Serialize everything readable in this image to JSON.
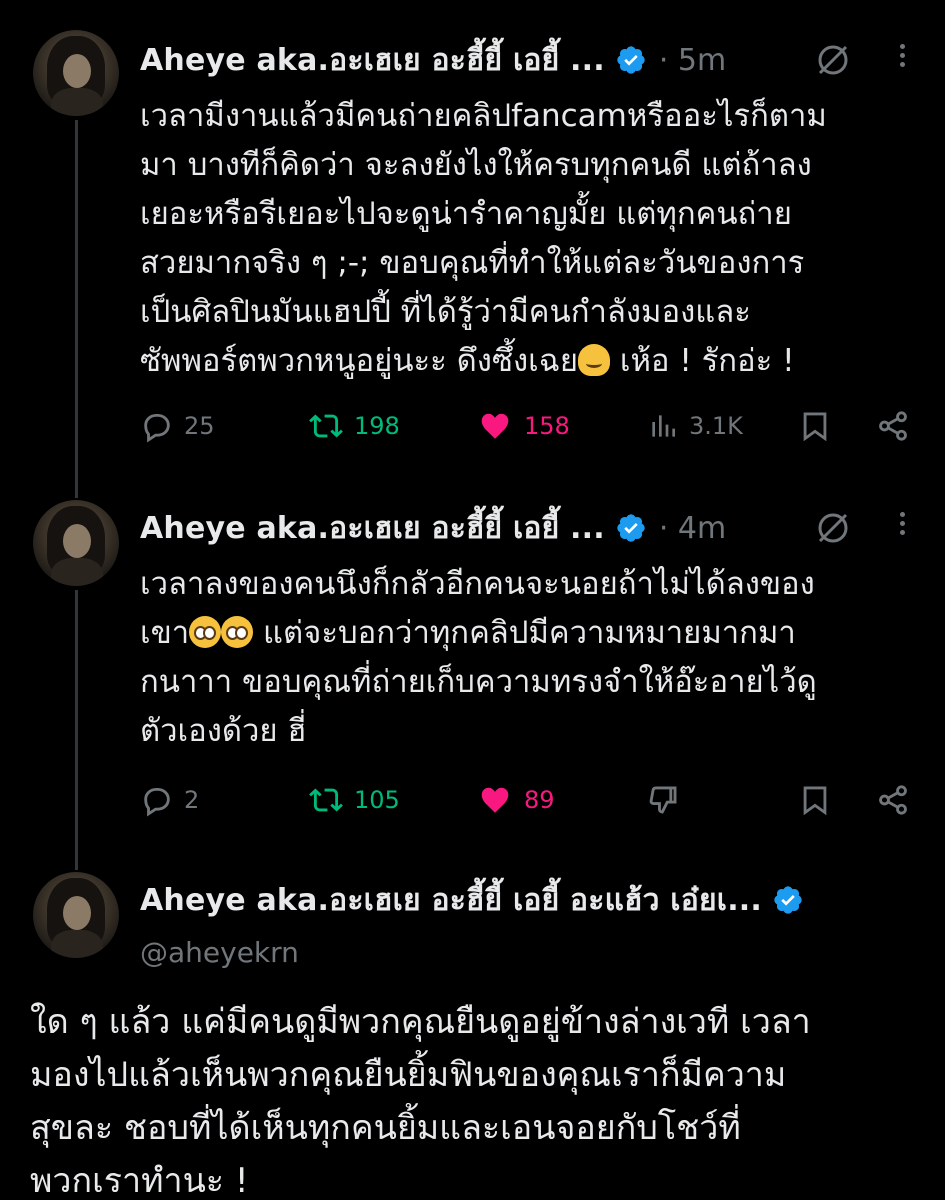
{
  "tweets": [
    {
      "name": "Aheye aka.อะเฮเย อะฮี้ยี้ เอยี้ ...",
      "time": "· 5m",
      "lines": [
        "เวลามีงานแล้วมีคนถ่ายคลิปfancamหรืออะไรก็ตาม",
        "มา บางทีก็คิดว่า จะลงยังไงให้ครบทุกคนดี แต่ถ้าลง",
        "เยอะหรือรีเยอะไปจะดูน่ารำคาญมั้ย แต่ทุกคนถ่าย",
        "สวยมากจริง ๆ ;-; ขอบคุณที่ทำให้แต่ละวันของการ",
        "เป็นศิลปินมันแฮปปี้ ที่ได้รู้ว่ามีคนกำลังมองและ",
        "ซัพพอร์ตพวกหนูอยู่นะะ ดึงซึ้งเฉย",
        " เห้อ ! รักอ่ะ !"
      ],
      "replies": "25",
      "reposts": "198",
      "likes": "158",
      "views": "3.1K"
    },
    {
      "name": "Aheye aka.อะเฮเย อะฮี้ยี้ เอยี้ ...",
      "time": "· 4m",
      "lines": [
        "เวลาลงของคนนึงก็กลัวอีกคนจะนอยถ้าไม่ได้ลงของ",
        "เขา",
        " แต่จะบอกว่าทุกคลิปมีความหมายมากมา",
        "กนาาา ขอบคุณที่ถ่ายเก็บความทรงจำให้อ๊ะอายไว้ดู",
        "ตัวเองด้วย ฮี่"
      ],
      "replies": "2",
      "reposts": "105",
      "likes": "89"
    }
  ],
  "main": {
    "name": "Aheye aka.อะเฮเย อะฮี้ยี้ เอยี้ อะแฮ้ว เอ๋ยเ...",
    "handle": "@aheyekrn",
    "lines": [
      "ใด ๆ แล้ว แค่มีคนดูมีพวกคุณยืนดูอยู่ข้างล่างเวที เวลา",
      "มองไปแล้วเห็นพวกคุณยืนยิ้มฟินของคุณเราก็มีความ",
      "สุขละ ชอบที่ได้เห็นทุกคนยิ้มและเอนจอยกับโชว์ที่",
      "พวกเราทำนะ !"
    ]
  },
  "colors": {
    "background": "#000000",
    "text": "#e7e9ea",
    "muted": "#71767b",
    "verified": "#1d9bf0",
    "repost": "#00ba7c",
    "like": "#f91880"
  },
  "icons": [
    "reply-icon",
    "repost-icon",
    "like-icon",
    "views-icon",
    "bookmark-icon",
    "share-icon",
    "grok-icon",
    "more-icon",
    "verified-badge-icon",
    "dislike-icon"
  ]
}
